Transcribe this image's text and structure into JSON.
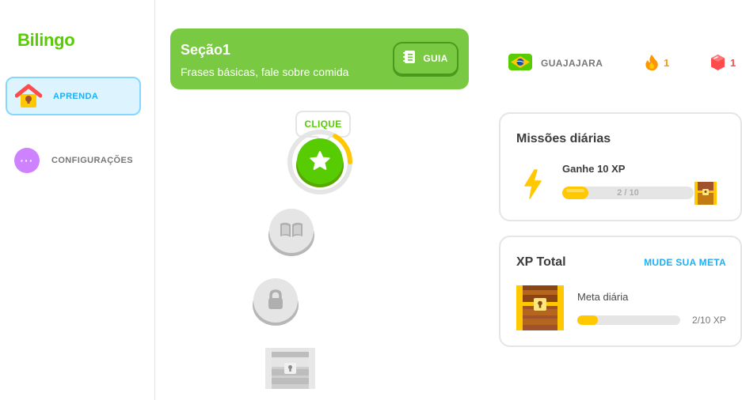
{
  "app": {
    "logo": "Bilingo"
  },
  "sidebar": {
    "items": [
      {
        "label": "APRENDA",
        "icon": "house-icon",
        "active": true
      },
      {
        "label": "CONFIGURAÇÕES",
        "icon": "more-dots-icon",
        "active": false
      }
    ]
  },
  "section": {
    "title": "Seção1",
    "subtitle": "Frases básicas, fale sobre comida",
    "guide_label": "GUIA",
    "guide_icon": "notebook-icon"
  },
  "path": {
    "tooltip": "CLIQUE",
    "nodes": [
      {
        "icon": "star-icon",
        "state": "current"
      },
      {
        "icon": "book-icon",
        "state": "locked"
      },
      {
        "icon": "lock-icon",
        "state": "locked"
      },
      {
        "icon": "treasure-chest-icon",
        "state": "locked"
      }
    ]
  },
  "stats": {
    "language": "GUAJAJARA",
    "flag_icon": "brazil-flag-icon",
    "streak": "1",
    "gems": "1"
  },
  "missions": {
    "title": "Missões diárias",
    "items": [
      {
        "name": "Ganhe 10 XP",
        "progress_text": "2 / 10",
        "progress": 0.2
      }
    ]
  },
  "xp": {
    "title": "XP Total",
    "change_goal": "MUDE SUA META",
    "goal_label": "Meta diária",
    "goal_text": "2/10 XP",
    "progress": 0.2
  },
  "colors": {
    "brand_green": "#58cc02",
    "banner_green": "#7ac943",
    "blue": "#1cb0f6",
    "gold": "#ffc800",
    "streak_orange": "#ff9600",
    "gem_red": "#ff4b4b"
  }
}
